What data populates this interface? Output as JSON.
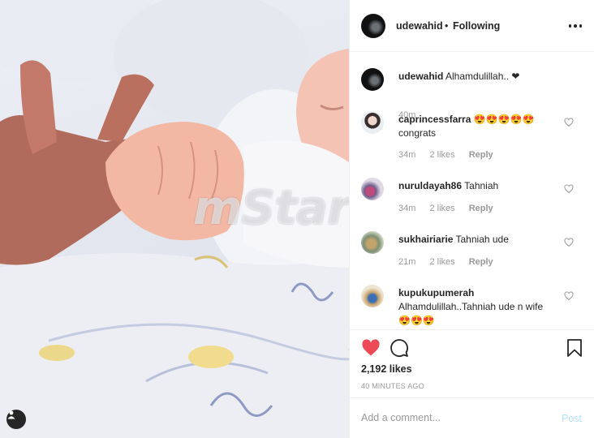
{
  "photo": {
    "watermark": "mStar"
  },
  "header": {
    "username": "udewahid",
    "separator": "•",
    "follow_status": "Following"
  },
  "caption": {
    "username": "udewahid",
    "text": "Alhamdulillah.. ❤",
    "time": "40m"
  },
  "comments": [
    {
      "username": "caprincessfarra",
      "text": "😍😍😍😍😍 congrats",
      "time": "34m",
      "likes": "2 likes",
      "reply": "Reply"
    },
    {
      "username": "nuruldayah86",
      "text": "Tahniah",
      "time": "34m",
      "likes": "2 likes",
      "reply": "Reply"
    },
    {
      "username": "sukhairiarie",
      "text": "Tahniah ude",
      "time": "21m",
      "likes": "2 likes",
      "reply": "Reply"
    },
    {
      "username": "kupukupumerah",
      "text": "Alhamdulillah..Tahniah ude n wife 😍😍😍",
      "time": "",
      "likes": "",
      "reply": ""
    }
  ],
  "actions": {
    "likes": "2,192 likes",
    "time_ago": "40 MINUTES AGO"
  },
  "add_comment": {
    "placeholder": "Add a comment...",
    "post_label": "Post"
  },
  "colors": {
    "liked_heart": "#ed4956",
    "post_disabled": "#b2dffc",
    "muted_text": "#999999"
  },
  "icons": [
    "more-options-icon",
    "heart-icon",
    "comment-icon",
    "bookmark-icon",
    "user-tag-icon"
  ]
}
